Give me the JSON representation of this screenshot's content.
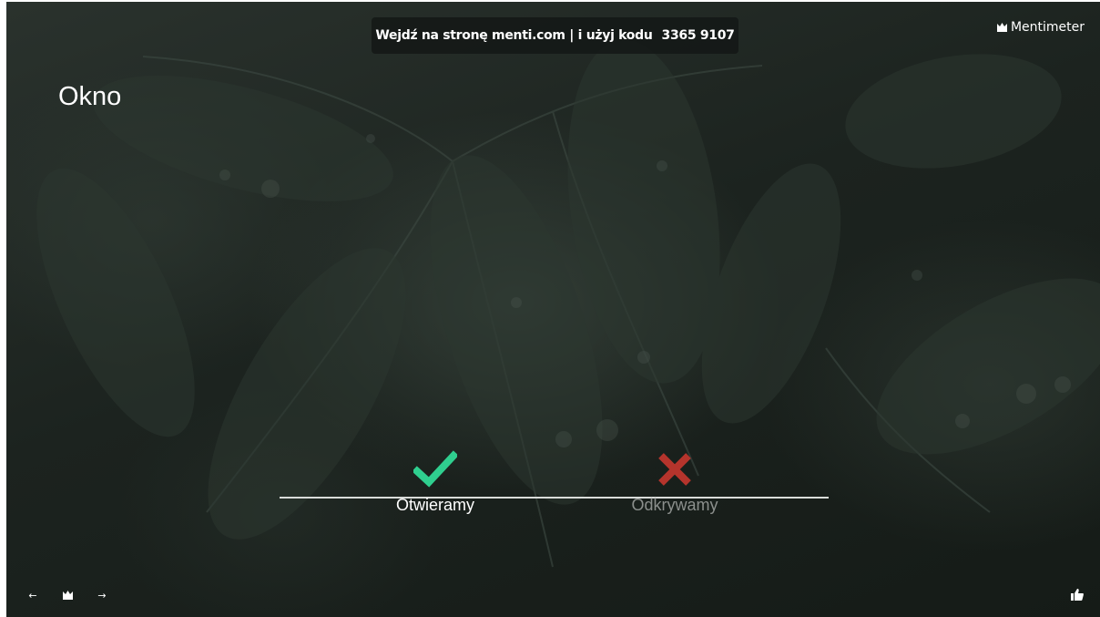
{
  "header": {
    "join_text": "Wejdź na stronę menti.com | i użyj kodu",
    "code": "3365 9107"
  },
  "brand": {
    "name": "Mentimeter",
    "icon": "mentimeter-logo-icon"
  },
  "slide": {
    "title": "Okno"
  },
  "options": [
    {
      "label": "Otwieramy",
      "icon": "checkmark-icon",
      "correct": true,
      "color": "#2fcf8f"
    },
    {
      "label": "Odkrywamy",
      "icon": "cross-icon",
      "correct": false,
      "color": "#b5342c"
    }
  ],
  "nav": {
    "prev": "←",
    "next": "→",
    "logo_icon": "mentimeter-logo-icon"
  },
  "reaction": {
    "icon": "thumbs-up-icon"
  },
  "colors": {
    "background": "#1c231f",
    "text": "#ffffff",
    "correct": "#2fcf8f",
    "wrong": "#b5342c",
    "muted_label": "#8b8f8c"
  }
}
